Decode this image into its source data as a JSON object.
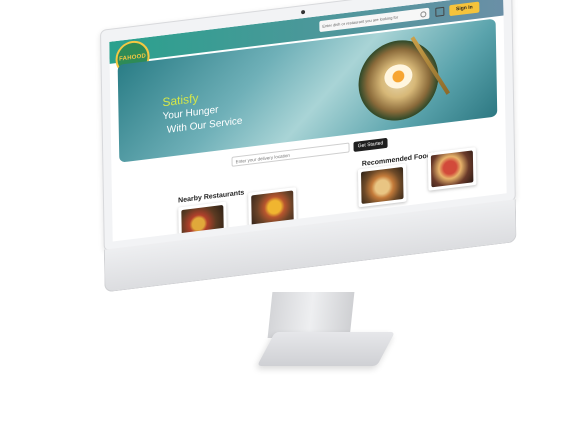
{
  "navbar": {
    "logo_text": "FAHOOD",
    "search_placeholder": "Enter dish or restaurant you are looking for",
    "signin_label": "Sign In"
  },
  "hero": {
    "line1": "Satisfy",
    "line2": "Your Hunger",
    "line3": "With Our Service"
  },
  "location": {
    "placeholder": "Enter your delivery location",
    "button_label": "Get Started"
  },
  "sections": {
    "nearby_title": "Nearby Restaurants",
    "recommended_title": "Recommended Food Items"
  },
  "icons": {
    "search": "search-icon",
    "cart": "cart-icon"
  },
  "colors": {
    "navbar": "#2aa18d",
    "signin": "#f5c33b",
    "hero_accent": "#d4e64a",
    "button": "#1f1f1f"
  }
}
